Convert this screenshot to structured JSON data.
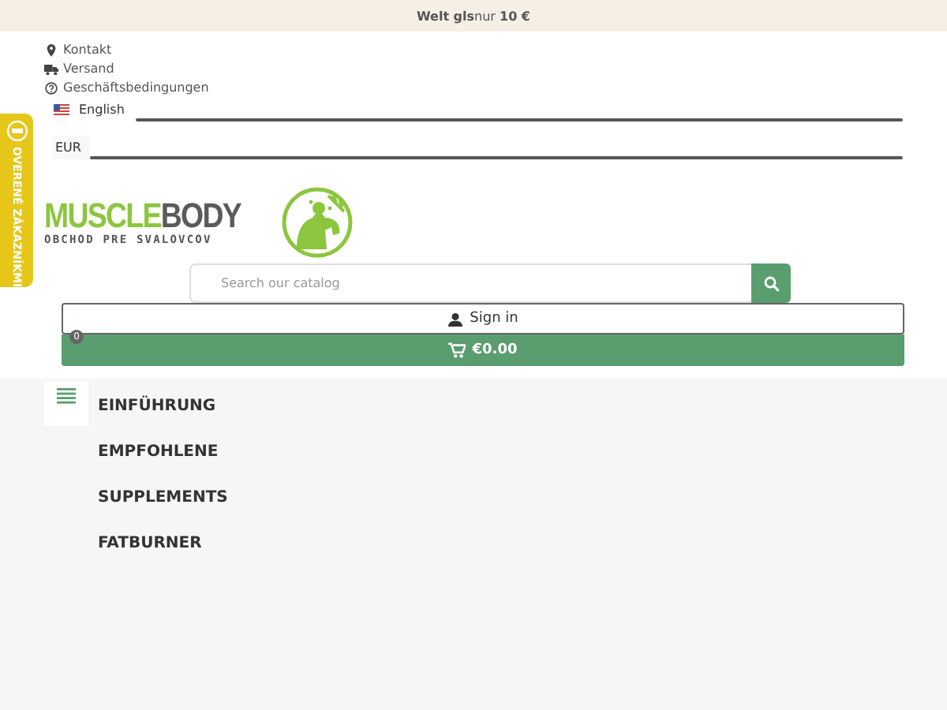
{
  "banner": {
    "text": "**Welt gls**nur **10 €**"
  },
  "top_links": [
    {
      "kind": "pin",
      "label": "Kontakt"
    },
    {
      "kind": "truck",
      "label": "Versand"
    },
    {
      "kind": "help",
      "label": "Geschäftsbedingungen"
    }
  ],
  "language": {
    "label": "English"
  },
  "currency": {
    "label": "EUR"
  },
  "side_tab": {
    "label": "OVERENÉ ZÁKAZNÍKMI"
  },
  "logo": {
    "name_first": "MUSCLE",
    "name_second": "BODY",
    "tagline": "OBCHOD PRE SVALOVCOV"
  },
  "search": {
    "placeholder": "Search our catalog"
  },
  "sign_in": {
    "label": "Sign in"
  },
  "cart": {
    "count": "0",
    "total": "€0.00"
  },
  "menu": [
    {
      "label": "EINFÜHRUNG"
    },
    {
      "label": "EMPFOHLENE"
    },
    {
      "label": "SUPPLEMENTS"
    },
    {
      "label": "FATBURNER"
    }
  ]
}
